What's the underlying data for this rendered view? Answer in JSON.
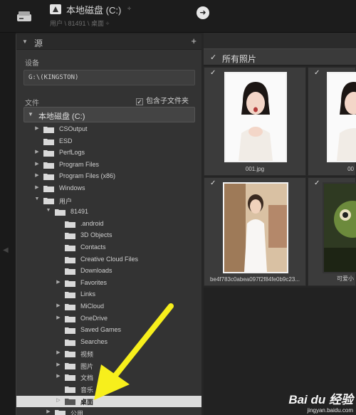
{
  "topbar": {
    "title": "本地磁盘 (C:)",
    "caret": "÷",
    "path": "用户 \\ 81491 \\ 桌面 ÷",
    "go_icon": "arrow-right-circle-icon"
  },
  "panel": {
    "title": "源",
    "add": "+",
    "devices_label": "设备",
    "device": "G:\\(KINGSTON)",
    "files_label": "文件",
    "include_subfolders": "包含子文件夹",
    "volume": "本地磁盘 (C:)"
  },
  "tree": [
    {
      "label": "CSOutput",
      "level": 1,
      "arrow": "▶"
    },
    {
      "label": "ESD",
      "level": 1,
      "arrow": ""
    },
    {
      "label": "PerfLogs",
      "level": 1,
      "arrow": "▶"
    },
    {
      "label": "Program Files",
      "level": 1,
      "arrow": "▶"
    },
    {
      "label": "Program Files (x86)",
      "level": 1,
      "arrow": "▶"
    },
    {
      "label": "Windows",
      "level": 1,
      "arrow": "▶"
    },
    {
      "label": "用户",
      "level": 1,
      "arrow": "▼"
    },
    {
      "label": "81491",
      "level": 2,
      "arrow": "▼"
    },
    {
      "label": ".android",
      "level": 3,
      "arrow": ""
    },
    {
      "label": "3D Objects",
      "level": 3,
      "arrow": ""
    },
    {
      "label": "Contacts",
      "level": 3,
      "arrow": ""
    },
    {
      "label": "Creative Cloud Files",
      "level": 3,
      "arrow": ""
    },
    {
      "label": "Downloads",
      "level": 3,
      "arrow": ""
    },
    {
      "label": "Favorites",
      "level": 3,
      "arrow": "▶"
    },
    {
      "label": "Links",
      "level": 3,
      "arrow": ""
    },
    {
      "label": "MiCloud",
      "level": 3,
      "arrow": "▶"
    },
    {
      "label": "OneDrive",
      "level": 3,
      "arrow": "▶"
    },
    {
      "label": "Saved Games",
      "level": 3,
      "arrow": ""
    },
    {
      "label": "Searches",
      "level": 3,
      "arrow": ""
    },
    {
      "label": "视频",
      "level": 3,
      "arrow": "▶"
    },
    {
      "label": "图片",
      "level": 3,
      "arrow": "▶"
    },
    {
      "label": "文档",
      "level": 3,
      "arrow": "▶"
    },
    {
      "label": "音乐",
      "level": 3,
      "arrow": ""
    },
    {
      "label": "桌面",
      "level": 3,
      "arrow": "▷",
      "selected": true
    },
    {
      "label": "公用",
      "level": 2,
      "arrow": "▶"
    }
  ],
  "grid": {
    "header": "所有照片",
    "photos": [
      {
        "caption": "001.jpg"
      },
      {
        "caption": "00"
      },
      {
        "caption": "be4f783c0abea097f2f84fe0b9c23..."
      },
      {
        "caption": "可爱小"
      }
    ]
  },
  "watermark": {
    "logo": "Bai du 经验",
    "url": "jingyan.baidu.com"
  },
  "colors": {
    "annotation_arrow": "#f7ef1c",
    "selected_row": "#dcdcdc"
  }
}
